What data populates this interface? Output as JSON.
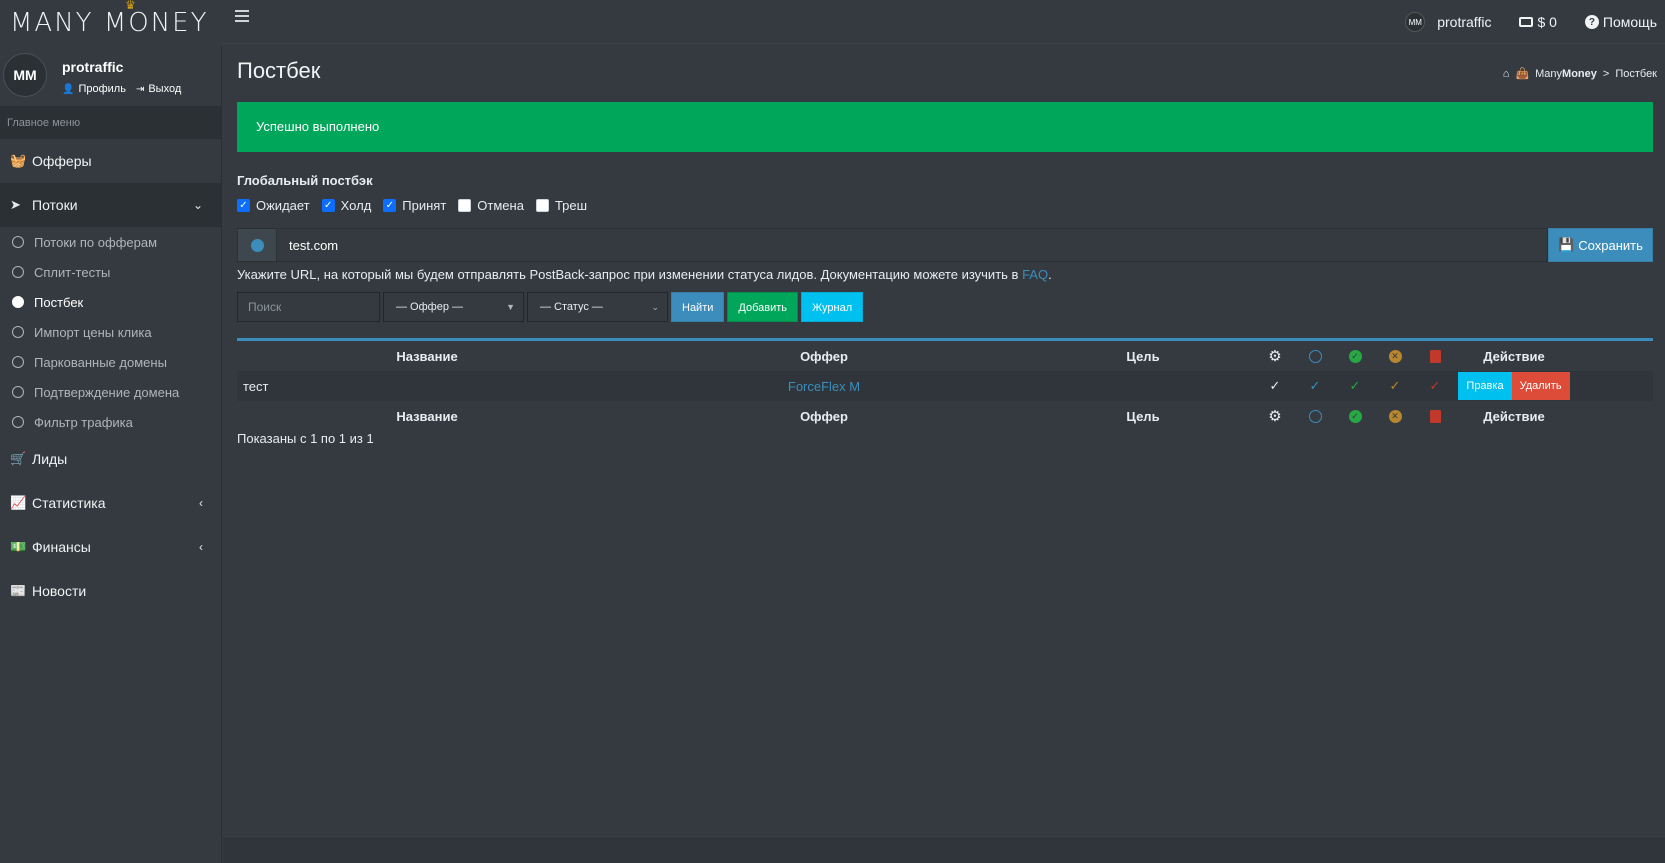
{
  "app": {
    "brand": "MANY MONEY",
    "crown": "♛"
  },
  "topnav": {
    "user": "protraffic",
    "avatar_text": "MM",
    "balance": "$ 0",
    "help": "Помощь"
  },
  "sidebar": {
    "user_name": "protraffic",
    "avatar_text": "MM",
    "profile_link": "Профиль",
    "logout_link": "Выход",
    "menu_header": "Главное меню",
    "items": [
      {
        "label": "Офферы",
        "icon": "basket-icon"
      },
      {
        "label": "Потоки",
        "icon": "paper-plane-icon"
      },
      {
        "label": "Лиды",
        "icon": "cart-icon"
      },
      {
        "label": "Статистика",
        "icon": "chart-icon"
      },
      {
        "label": "Финансы",
        "icon": "money-icon"
      },
      {
        "label": "Новости",
        "icon": "newspaper-icon"
      }
    ],
    "subitems": [
      {
        "label": "Потоки по офферам"
      },
      {
        "label": "Сплит-тесты"
      },
      {
        "label": "Постбек"
      },
      {
        "label": "Импорт цены клика"
      },
      {
        "label": "Паркованные домены"
      },
      {
        "label": "Подтверждение домена"
      },
      {
        "label": "Фильтр трафика"
      }
    ]
  },
  "page": {
    "title": "Постбек",
    "breadcrumb": {
      "home": "ManyMoney",
      "home_bold": "Money",
      "home_light": "Many",
      "sep": ">",
      "current": "Постбек"
    },
    "alert": "Успешно выполнено",
    "global_title": "Глобальный постбэк",
    "statuses": [
      {
        "label": "Ожидает",
        "checked": true
      },
      {
        "label": "Холд",
        "checked": true
      },
      {
        "label": "Принят",
        "checked": true
      },
      {
        "label": "Отмена",
        "checked": false
      },
      {
        "label": "Треш",
        "checked": false
      }
    ],
    "url_value": "test.com",
    "save_label": "Сохранить",
    "hint_text": "Укажите URL, на который мы будем отправлять PostBack-запрос при изменении статуса лидов. Документацию можете изучить в ",
    "hint_link": "FAQ",
    "hint_end": "."
  },
  "filters": {
    "search_placeholder": "Поиск",
    "offer_select": "— Оффер —",
    "status_select": "— Статус —",
    "find_label": "Найти",
    "add_label": "Добавить",
    "log_label": "Журнал"
  },
  "table": {
    "headers": {
      "name": "Название",
      "offer": "Оффер",
      "goal": "Цель",
      "action": "Действие"
    },
    "rows": [
      {
        "name": "тест",
        "offer": "ForceFlex M",
        "goal": "",
        "edit": "Правка",
        "delete": "Удалить"
      }
    ],
    "summary": "Показаны с 1 по 1 из 1"
  },
  "colors": {
    "accent": "#3c8dbc",
    "success": "#00a65a",
    "info": "#00c0ef",
    "danger": "#dd4b39",
    "background": "#343a40"
  }
}
